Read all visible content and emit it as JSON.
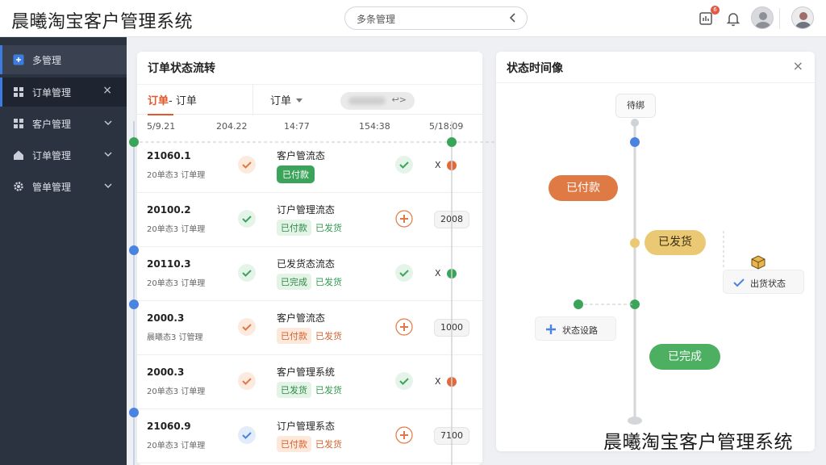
{
  "app": {
    "title": "晨曦淘宝客户管理系统",
    "watermark": "晨曦淘宝客户管理系统"
  },
  "header": {
    "search_text": "多条管理",
    "notification_count": "6"
  },
  "sidebar": {
    "items": [
      {
        "label": "多管理",
        "icon": "plus-square-icon",
        "has_chevron": false
      },
      {
        "label": "订单管理",
        "icon": "grid-icon",
        "close": "×"
      },
      {
        "label": "客户管理",
        "icon": "grid-icon"
      },
      {
        "label": "订单管理",
        "icon": "home-icon"
      },
      {
        "label": "管单管理",
        "icon": "gear-icon"
      }
    ]
  },
  "left_panel": {
    "title": "订单状态流转",
    "tab_a_accent": "订单",
    "tab_a_rest": "- 订单",
    "tab_b": "订单",
    "pill_arrow": "↩>",
    "axis": [
      "5/9.21",
      "204.22",
      "14:77",
      "154:38",
      "5/18:09"
    ],
    "rows": [
      {
        "id": "21060.1",
        "sub": "20单态3  订单理",
        "desc": "客户管流态",
        "tag": "已付款",
        "tag_style": "solid",
        "after": "",
        "after_style": "",
        "mark1": "check",
        "mark1_color": "orange",
        "mark2": "check",
        "mark2_color": "green",
        "end": "X",
        "end_kind": "x-dot",
        "dot_color": "#e06a3c"
      },
      {
        "id": "20100.2",
        "sub": "20单态3  订单理",
        "desc": "订户管理流态",
        "tag": "已付款",
        "tag_style": "green",
        "after": "已发货",
        "after_style": "green",
        "mark1": "check",
        "mark1_color": "green",
        "mark2": "plus",
        "mark2_color": "orange",
        "end": "2008",
        "end_kind": "box",
        "dot_color": ""
      },
      {
        "id": "20110.3",
        "sub": "20单态3  订单理",
        "desc": "已发货态流态",
        "tag": "已完成",
        "tag_style": "green",
        "after": "已发货",
        "after_style": "green",
        "mark1": "check",
        "mark1_color": "green",
        "mark2": "check",
        "mark2_color": "green",
        "end": "X",
        "end_kind": "x-dot-1",
        "dot_color": "#3aa55a"
      },
      {
        "id": "2000.3",
        "sub": "晨曦态3  订管理",
        "desc": "客户管流态",
        "tag": "已付款",
        "tag_style": "orange",
        "after": "已发货",
        "after_style": "orange",
        "mark1": "check",
        "mark1_color": "orange",
        "mark2": "plus",
        "mark2_color": "orange",
        "end": "1000",
        "end_kind": "box",
        "dot_color": ""
      },
      {
        "id": "2000.3",
        "sub": "20单态3  订单理",
        "desc": "客户管理系统",
        "tag": "已发货",
        "tag_style": "green",
        "after": "已发货",
        "after_style": "green",
        "mark1": "check",
        "mark1_color": "orange",
        "mark2": "check",
        "mark2_color": "green",
        "end": "X",
        "end_kind": "x-dot",
        "dot_color": "#e06a3c"
      },
      {
        "id": "21060.9",
        "sub": "20单态3  订单理",
        "desc": "订户管理系态",
        "tag": "已付款",
        "tag_style": "orange",
        "after": "已发货",
        "after_style": "orange",
        "mark1": "check",
        "mark1_color": "blue",
        "mark2": "plus",
        "mark2_color": "orange",
        "end": "7100",
        "end_kind": "box",
        "dot_color": ""
      }
    ]
  },
  "right_panel": {
    "title": "状态时间像",
    "close": "×",
    "start_node": "待绑",
    "paid": "已付款",
    "shipped": "已发货",
    "completed": "已完成",
    "side_right": "出货状态",
    "side_left": "状态设路"
  },
  "colors": {
    "accent_orange": "#e2572b",
    "paid_orange": "#e07a45",
    "shipped_yellow": "#ebc873",
    "completed_green": "#4caf62",
    "line_blue": "#4a83e0",
    "line_green": "#3aa55a"
  }
}
